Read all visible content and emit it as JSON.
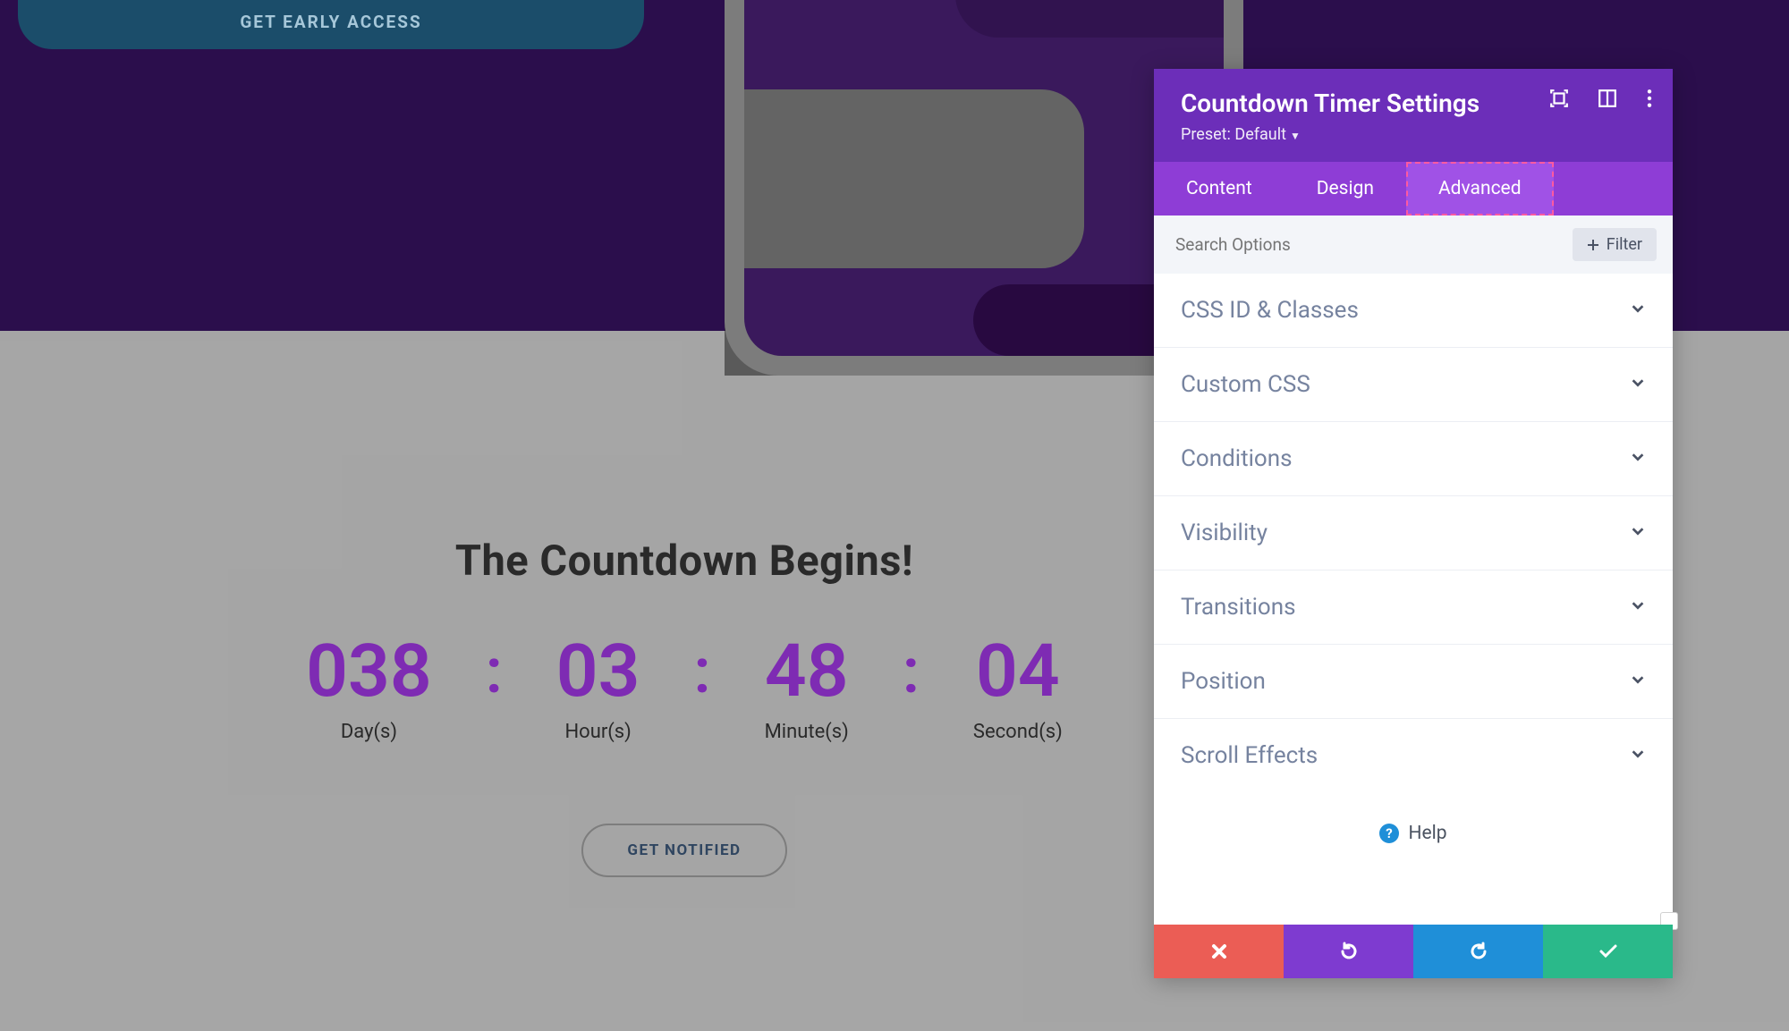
{
  "hero": {
    "cta_label": "GET EARLY ACCESS"
  },
  "countdown": {
    "title": "The Countdown Begins!",
    "days": "038",
    "days_label": "Day(s)",
    "hours": "03",
    "hours_label": "Hour(s)",
    "minutes": "48",
    "minutes_label": "Minute(s)",
    "seconds": "04",
    "seconds_label": "Second(s)",
    "notify_label": "GET NOTIFIED"
  },
  "panel": {
    "title": "Countdown Timer Settings",
    "preset_label": "Preset: Default",
    "tabs": {
      "content": "Content",
      "design": "Design",
      "advanced": "Advanced"
    },
    "search_placeholder": "Search Options",
    "filter_label": "Filter",
    "options": [
      "CSS ID & Classes",
      "Custom CSS",
      "Conditions",
      "Visibility",
      "Transitions",
      "Position",
      "Scroll Effects"
    ],
    "help_label": "Help"
  }
}
